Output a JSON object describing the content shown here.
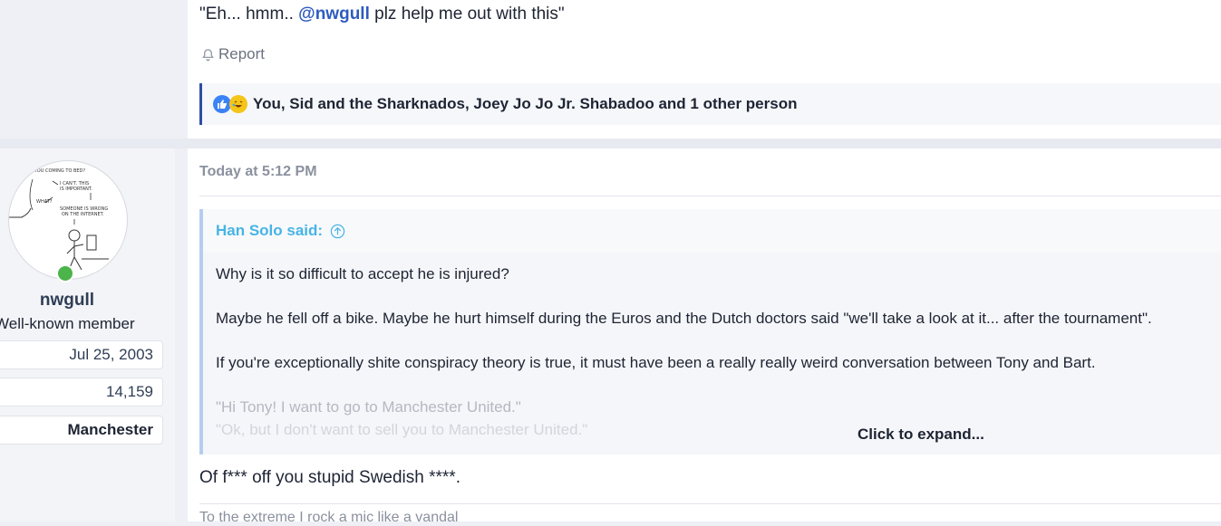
{
  "prev_post": {
    "quote_text_pre": "\"Eh... hmm.. ",
    "mention": "@nwgull",
    "quote_text_post": " plz help me out with this\"",
    "report_label": "Report",
    "reactions_text": "You, Sid and the Sharknados, Joey Jo Jo Jr. Shabadoo and 1 other person",
    "reaction_icons": [
      "like-icon",
      "laugh-icon"
    ]
  },
  "user": {
    "name": "nwgull",
    "title": "Well-known member",
    "joined": "Jul 25, 2003",
    "messages": "14,159",
    "location": "Manchester",
    "online": true,
    "avatar_text": [
      "YOU COMING TO BED?",
      "I CAN'T. THIS IS IMPORTANT.",
      "WHAT?",
      "SOMEONE IS WRONG ON THE INTERNET."
    ]
  },
  "post": {
    "date": "Today at 5:12 PM",
    "quote_author": "Han Solo said:",
    "quote_lines": [
      "Why is it so difficult to accept he is injured?",
      "Maybe he fell off a bike. Maybe he hurt himself during the Euros and the Dutch doctors said \"we'll take a look at it... after the tournament\".",
      "If you're exceptionally shite conspiracy theory is true, it must have been a really really weird conversation between Tony and Bart.",
      "\"Hi Tony! I want to go to Manchester United.\"",
      "\"Ok, but I don't want to sell you to Manchester United.\""
    ],
    "expand_label": "Click to expand...",
    "reply": "Of f*** off you stupid Swedish ****.",
    "signature": "To the extreme I rock a mic like a vandal"
  }
}
